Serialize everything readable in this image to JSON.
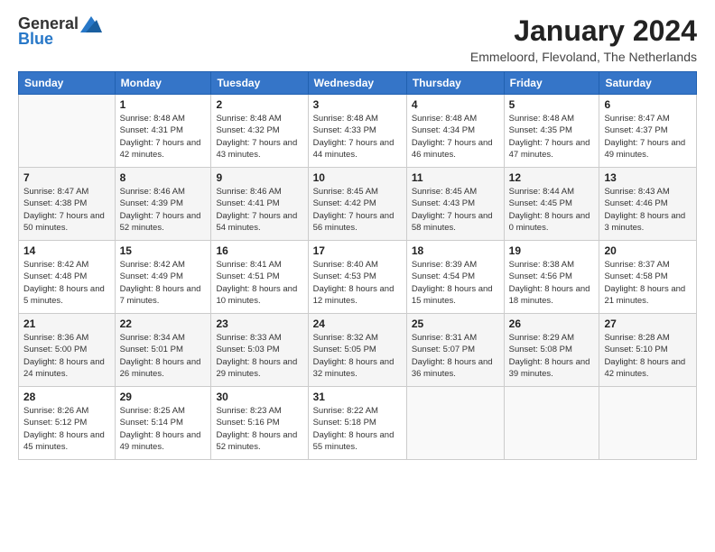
{
  "logo": {
    "general": "General",
    "blue": "Blue"
  },
  "title": "January 2024",
  "subtitle": "Emmeloord, Flevoland, The Netherlands",
  "headers": [
    "Sunday",
    "Monday",
    "Tuesday",
    "Wednesday",
    "Thursday",
    "Friday",
    "Saturday"
  ],
  "weeks": [
    [
      {
        "day": "",
        "sunrise": "",
        "sunset": "",
        "daylight": ""
      },
      {
        "day": "1",
        "sunrise": "Sunrise: 8:48 AM",
        "sunset": "Sunset: 4:31 PM",
        "daylight": "Daylight: 7 hours and 42 minutes."
      },
      {
        "day": "2",
        "sunrise": "Sunrise: 8:48 AM",
        "sunset": "Sunset: 4:32 PM",
        "daylight": "Daylight: 7 hours and 43 minutes."
      },
      {
        "day": "3",
        "sunrise": "Sunrise: 8:48 AM",
        "sunset": "Sunset: 4:33 PM",
        "daylight": "Daylight: 7 hours and 44 minutes."
      },
      {
        "day": "4",
        "sunrise": "Sunrise: 8:48 AM",
        "sunset": "Sunset: 4:34 PM",
        "daylight": "Daylight: 7 hours and 46 minutes."
      },
      {
        "day": "5",
        "sunrise": "Sunrise: 8:48 AM",
        "sunset": "Sunset: 4:35 PM",
        "daylight": "Daylight: 7 hours and 47 minutes."
      },
      {
        "day": "6",
        "sunrise": "Sunrise: 8:47 AM",
        "sunset": "Sunset: 4:37 PM",
        "daylight": "Daylight: 7 hours and 49 minutes."
      }
    ],
    [
      {
        "day": "7",
        "sunrise": "Sunrise: 8:47 AM",
        "sunset": "Sunset: 4:38 PM",
        "daylight": "Daylight: 7 hours and 50 minutes."
      },
      {
        "day": "8",
        "sunrise": "Sunrise: 8:46 AM",
        "sunset": "Sunset: 4:39 PM",
        "daylight": "Daylight: 7 hours and 52 minutes."
      },
      {
        "day": "9",
        "sunrise": "Sunrise: 8:46 AM",
        "sunset": "Sunset: 4:41 PM",
        "daylight": "Daylight: 7 hours and 54 minutes."
      },
      {
        "day": "10",
        "sunrise": "Sunrise: 8:45 AM",
        "sunset": "Sunset: 4:42 PM",
        "daylight": "Daylight: 7 hours and 56 minutes."
      },
      {
        "day": "11",
        "sunrise": "Sunrise: 8:45 AM",
        "sunset": "Sunset: 4:43 PM",
        "daylight": "Daylight: 7 hours and 58 minutes."
      },
      {
        "day": "12",
        "sunrise": "Sunrise: 8:44 AM",
        "sunset": "Sunset: 4:45 PM",
        "daylight": "Daylight: 8 hours and 0 minutes."
      },
      {
        "day": "13",
        "sunrise": "Sunrise: 8:43 AM",
        "sunset": "Sunset: 4:46 PM",
        "daylight": "Daylight: 8 hours and 3 minutes."
      }
    ],
    [
      {
        "day": "14",
        "sunrise": "Sunrise: 8:42 AM",
        "sunset": "Sunset: 4:48 PM",
        "daylight": "Daylight: 8 hours and 5 minutes."
      },
      {
        "day": "15",
        "sunrise": "Sunrise: 8:42 AM",
        "sunset": "Sunset: 4:49 PM",
        "daylight": "Daylight: 8 hours and 7 minutes."
      },
      {
        "day": "16",
        "sunrise": "Sunrise: 8:41 AM",
        "sunset": "Sunset: 4:51 PM",
        "daylight": "Daylight: 8 hours and 10 minutes."
      },
      {
        "day": "17",
        "sunrise": "Sunrise: 8:40 AM",
        "sunset": "Sunset: 4:53 PM",
        "daylight": "Daylight: 8 hours and 12 minutes."
      },
      {
        "day": "18",
        "sunrise": "Sunrise: 8:39 AM",
        "sunset": "Sunset: 4:54 PM",
        "daylight": "Daylight: 8 hours and 15 minutes."
      },
      {
        "day": "19",
        "sunrise": "Sunrise: 8:38 AM",
        "sunset": "Sunset: 4:56 PM",
        "daylight": "Daylight: 8 hours and 18 minutes."
      },
      {
        "day": "20",
        "sunrise": "Sunrise: 8:37 AM",
        "sunset": "Sunset: 4:58 PM",
        "daylight": "Daylight: 8 hours and 21 minutes."
      }
    ],
    [
      {
        "day": "21",
        "sunrise": "Sunrise: 8:36 AM",
        "sunset": "Sunset: 5:00 PM",
        "daylight": "Daylight: 8 hours and 24 minutes."
      },
      {
        "day": "22",
        "sunrise": "Sunrise: 8:34 AM",
        "sunset": "Sunset: 5:01 PM",
        "daylight": "Daylight: 8 hours and 26 minutes."
      },
      {
        "day": "23",
        "sunrise": "Sunrise: 8:33 AM",
        "sunset": "Sunset: 5:03 PM",
        "daylight": "Daylight: 8 hours and 29 minutes."
      },
      {
        "day": "24",
        "sunrise": "Sunrise: 8:32 AM",
        "sunset": "Sunset: 5:05 PM",
        "daylight": "Daylight: 8 hours and 32 minutes."
      },
      {
        "day": "25",
        "sunrise": "Sunrise: 8:31 AM",
        "sunset": "Sunset: 5:07 PM",
        "daylight": "Daylight: 8 hours and 36 minutes."
      },
      {
        "day": "26",
        "sunrise": "Sunrise: 8:29 AM",
        "sunset": "Sunset: 5:08 PM",
        "daylight": "Daylight: 8 hours and 39 minutes."
      },
      {
        "day": "27",
        "sunrise": "Sunrise: 8:28 AM",
        "sunset": "Sunset: 5:10 PM",
        "daylight": "Daylight: 8 hours and 42 minutes."
      }
    ],
    [
      {
        "day": "28",
        "sunrise": "Sunrise: 8:26 AM",
        "sunset": "Sunset: 5:12 PM",
        "daylight": "Daylight: 8 hours and 45 minutes."
      },
      {
        "day": "29",
        "sunrise": "Sunrise: 8:25 AM",
        "sunset": "Sunset: 5:14 PM",
        "daylight": "Daylight: 8 hours and 49 minutes."
      },
      {
        "day": "30",
        "sunrise": "Sunrise: 8:23 AM",
        "sunset": "Sunset: 5:16 PM",
        "daylight": "Daylight: 8 hours and 52 minutes."
      },
      {
        "day": "31",
        "sunrise": "Sunrise: 8:22 AM",
        "sunset": "Sunset: 5:18 PM",
        "daylight": "Daylight: 8 hours and 55 minutes."
      },
      {
        "day": "",
        "sunrise": "",
        "sunset": "",
        "daylight": ""
      },
      {
        "day": "",
        "sunrise": "",
        "sunset": "",
        "daylight": ""
      },
      {
        "day": "",
        "sunrise": "",
        "sunset": "",
        "daylight": ""
      }
    ]
  ]
}
